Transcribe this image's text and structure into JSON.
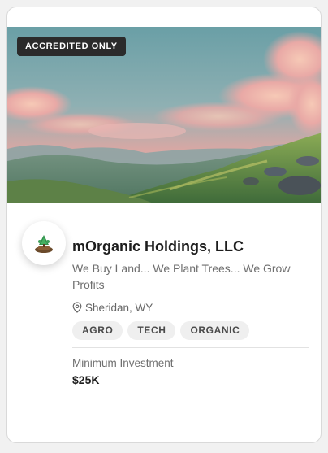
{
  "card": {
    "badge": "ACCREDITED ONLY",
    "company_name": "mOrganic Holdings, LLC",
    "description": "We Buy Land... We Plant Trees... We Grow Profits",
    "location": "Sheridan, WY",
    "tags": [
      "AGRO",
      "TECH",
      "ORGANIC"
    ],
    "investment_label": "Minimum Investment",
    "investment_value": "$25K"
  },
  "icons": {
    "location": "map-pin-icon",
    "logo": "company-logo"
  },
  "colors": {
    "badge_bg": "#2b2b2b",
    "tag_bg": "#efefef",
    "title": "#1d1d1d",
    "muted_text": "#6f6f6f"
  }
}
